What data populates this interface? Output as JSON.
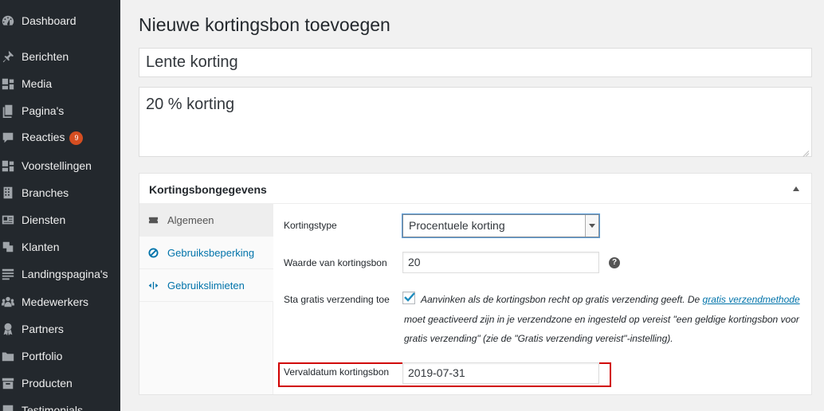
{
  "sidebar": {
    "items": [
      {
        "label": "Dashboard",
        "icon": "dashboard-icon"
      },
      {
        "label": "Berichten",
        "icon": "pin-icon"
      },
      {
        "label": "Media",
        "icon": "media-icon"
      },
      {
        "label": "Pagina's",
        "icon": "pages-icon"
      },
      {
        "label": "Reacties",
        "icon": "comments-icon",
        "badge": "9"
      },
      {
        "label": "Voorstellingen",
        "icon": "media-icon"
      },
      {
        "label": "Branches",
        "icon": "building-icon"
      },
      {
        "label": "Diensten",
        "icon": "id-card-icon"
      },
      {
        "label": "Klanten",
        "icon": "clients-icon"
      },
      {
        "label": "Landingspagina's",
        "icon": "text-page-icon"
      },
      {
        "label": "Medewerkers",
        "icon": "groups-icon"
      },
      {
        "label": "Partners",
        "icon": "award-icon"
      },
      {
        "label": "Portfolio",
        "icon": "portfolio-icon"
      },
      {
        "label": "Producten",
        "icon": "archive-icon"
      },
      {
        "label": "Testimonials",
        "icon": "testimonial-icon"
      }
    ]
  },
  "page": {
    "title": "Nieuwe kortingsbon toevoegen",
    "coupon_code": "Lente korting",
    "description": "20 % korting"
  },
  "postbox": {
    "title": "Kortingsbongegevens",
    "tabs": [
      {
        "label": "Algemeen",
        "icon": "ticket-icon",
        "active": true
      },
      {
        "label": "Gebruiksbeperking",
        "icon": "block-icon",
        "active": false
      },
      {
        "label": "Gebruikslimieten",
        "icon": "limits-icon",
        "active": false
      }
    ],
    "fields": {
      "type_label": "Kortingstype",
      "type_value": "Procentuele korting",
      "amount_label": "Waarde van kortingsbon",
      "amount_value": "20",
      "free_shipping_label": "Sta gratis verzending toe",
      "free_shipping_checked": true,
      "free_shipping_desc_1": "Aanvinken als de kortingsbon recht op gratis verzending geeft. De ",
      "free_shipping_link": "gratis verzendmethode",
      "free_shipping_desc_2": " moet geactiveerd zijn in je verzendzone en ingesteld op vereist \"een geldige kortingsbon voor gratis verzending\" (zie de \"Gratis verzending vereist\"-instelling).",
      "expiry_label": "Vervaldatum kortingsbon",
      "expiry_value": "2019-07-31"
    }
  },
  "colors": {
    "sidebar_bg": "#23282d",
    "link": "#0073aa",
    "badge": "#d54e21",
    "highlight": "#d10000"
  }
}
